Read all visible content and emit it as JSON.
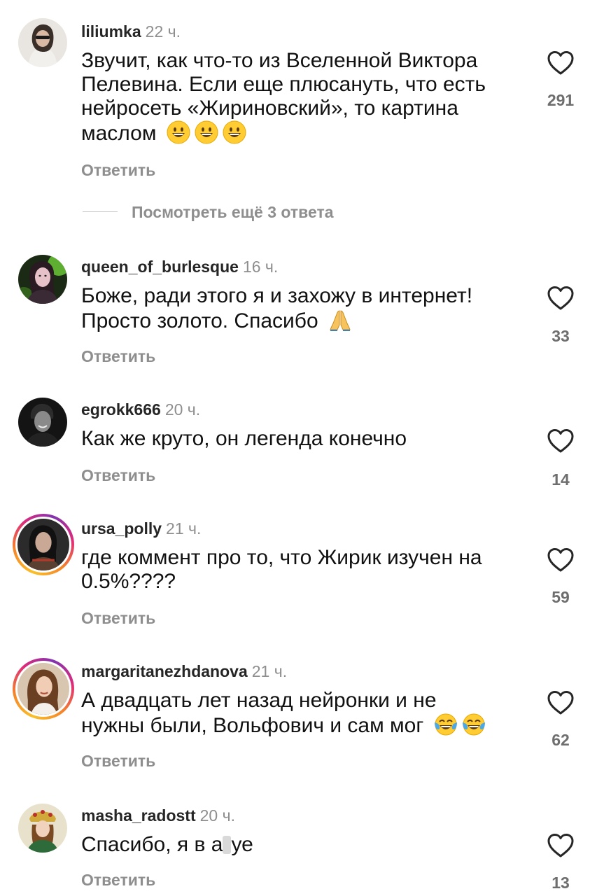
{
  "comments": [
    {
      "username": "liliumka",
      "time": "22 ч.",
      "text_lines": [
        "Звучит, как что-то из Вселенной Виктора",
        "Пелевина. Если еще плюсануть, что есть",
        "нейросеть «Жириновский», то картина",
        "маслом"
      ],
      "emoji": [
        "grinning-face",
        "grinning-face",
        "grinning-face"
      ],
      "reply_label": "Ответить",
      "likes": "291",
      "story_ring": false
    },
    {
      "username": "queen_of_burlesque",
      "time": "16 ч.",
      "text_lines": [
        "Боже, ради этого я и захожу в интернет!",
        "Просто золото. Спасибо"
      ],
      "emoji": [
        "folded-hands"
      ],
      "reply_label": "Ответить",
      "likes": "33",
      "story_ring": false
    },
    {
      "username": "egrokk666",
      "time": "20 ч.",
      "text_lines": [
        "Как же круто, он легенда конечно"
      ],
      "emoji": [],
      "reply_label": "Ответить",
      "likes": "14",
      "story_ring": false
    },
    {
      "username": "ursa_polly",
      "time": "21 ч.",
      "text_lines": [
        "где коммент про то, что Жирик изучен на",
        "0.5%????"
      ],
      "emoji": [],
      "reply_label": "Ответить",
      "likes": "59",
      "story_ring": true
    },
    {
      "username": "margaritanezhdanova",
      "time": "21 ч.",
      "text_lines": [
        "А двадцать лет назад нейронки и не",
        "нужны были, Вольфович и сам мог"
      ],
      "emoji": [
        "tears-of-joy",
        "tears-of-joy"
      ],
      "reply_label": "Ответить",
      "likes": "62",
      "story_ring": true
    },
    {
      "username": "masha_radostt",
      "time": "20 ч.",
      "text_lines": [
        "Спасибо, я в а",
        "уе"
      ],
      "emoji": [],
      "reply_label": "Ответить",
      "likes": "13",
      "story_ring": false
    }
  ],
  "more_replies": {
    "label": "Посмотреть ещё 3 ответа"
  },
  "colors": {
    "username": "#262626",
    "secondary": "#8e8e8e",
    "like_icon": "#262626",
    "story_ring": [
      "#f9c02a",
      "#f58529",
      "#dd2a7b",
      "#8134af"
    ]
  },
  "icons": {
    "like": "heart-outline-icon"
  }
}
